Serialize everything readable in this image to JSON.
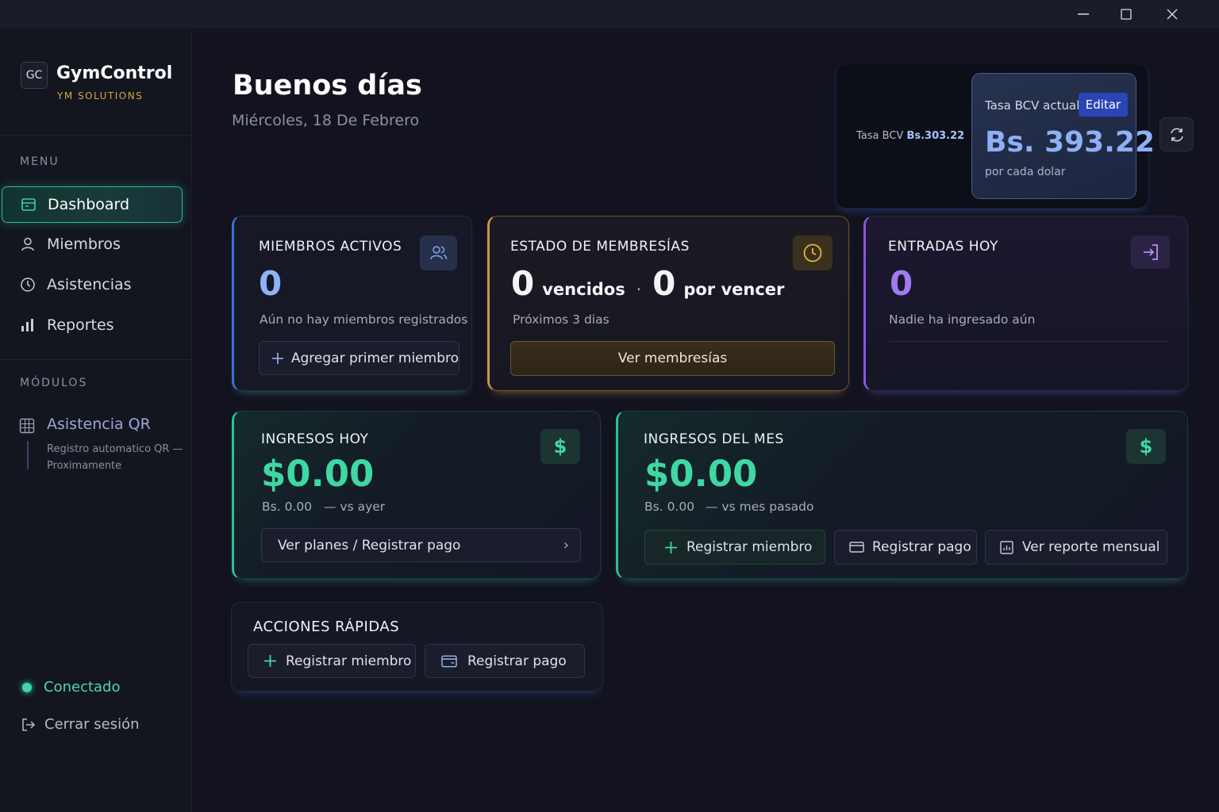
{
  "window": {
    "minimize": "—",
    "maximize": "☐",
    "close": "✕"
  },
  "sidebar": {
    "logo_initials": "GC",
    "app_name": "GymControl",
    "company": "YM SOLUTIONS",
    "menu_label": "MENU",
    "items": [
      {
        "label": "Dashboard",
        "icon": "dashboard-icon",
        "active": true
      },
      {
        "label": "Miembros",
        "icon": "user-icon"
      },
      {
        "label": "Asistencias",
        "icon": "clock-icon"
      },
      {
        "label": "Reportes",
        "icon": "bar-chart-icon"
      }
    ],
    "modules_label": "MÓDULOS",
    "module": {
      "title": "Asistencia QR",
      "description": "Registro automatico QR — Proximamente"
    },
    "status": "Conectado",
    "logout": "Cerrar sesión"
  },
  "header": {
    "greeting": "Buenos días",
    "date": "Miércoles, 18 De Febrero"
  },
  "rate": {
    "small_label": "Tasa BCV",
    "small_value": "Bs.303.22",
    "card_label": "Tasa BCV actual",
    "edit_label": "Editar",
    "value": "Bs. 393.22",
    "caption": "por cada dolar"
  },
  "members_card": {
    "title": "MIEMBROS ACTIVOS",
    "value": "0",
    "subtitle": "Aún no hay miembros registrados",
    "button": "Agregar primer miembro"
  },
  "memberships_card": {
    "title": "ESTADO DE MEMBRESÍAS",
    "expired_value": "0",
    "expired_label": "vencidos",
    "separator": "·",
    "expiring_value": "0",
    "expiring_label": "por vencer",
    "subtitle": "Próximos 3 dias",
    "button": "Ver membresías"
  },
  "entries_card": {
    "title": "ENTRADAS HOY",
    "value": "0",
    "subtitle": "Nadie ha ingresado aún"
  },
  "income_today": {
    "title": "INGRESOS HOY",
    "value": "$0.00",
    "bs": "Bs. 0.00",
    "compare": "— vs ayer",
    "button": "Ver planes / Registrar pago",
    "chevron": "›"
  },
  "income_month": {
    "title": "INGRESOS DEL MES",
    "value": "$0.00",
    "bs": "Bs. 0.00",
    "compare": "— vs mes pasado",
    "buttons": [
      "Registrar miembro",
      "Registrar pago",
      "Ver reporte mensual"
    ]
  },
  "quick_actions": {
    "title": "ACCIONES RÁPIDAS",
    "buttons": [
      "Registrar miembro",
      "Registrar pago"
    ]
  },
  "colors": {
    "accent_green": "#3ed8a4",
    "accent_blue": "#8eb0f4",
    "accent_gold": "#c79743",
    "accent_purple": "#a27af0"
  }
}
